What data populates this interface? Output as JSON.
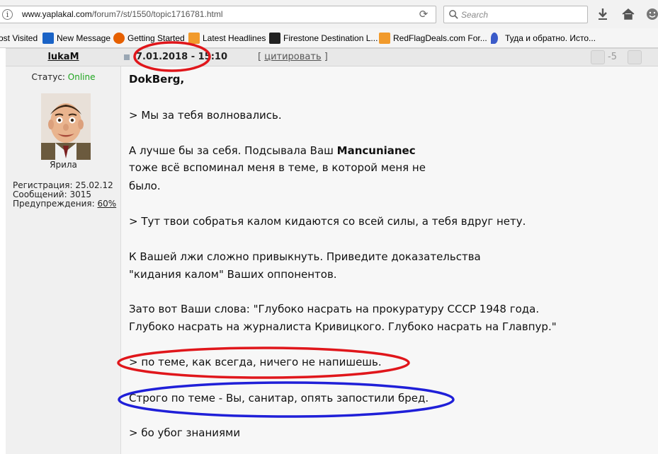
{
  "browser": {
    "url_host": "www.yaplakal.com",
    "url_path": "/forum7/st/1550/topic1716781.html",
    "search_placeholder": "Search",
    "bookmarks": [
      {
        "label": "ost Visited",
        "icon": "firefox-icon"
      },
      {
        "label": "New Message",
        "icon": "outlook-icon"
      },
      {
        "label": "Getting Started",
        "icon": "firefox-icon"
      },
      {
        "label": "Latest Headlines",
        "icon": "rss-icon"
      },
      {
        "label": "Firestone Destination L...",
        "icon": "firestone-icon"
      },
      {
        "label": "RedFlagDeals.com For...",
        "icon": "rss-icon"
      },
      {
        "label": "Туда и обратно. Исто...",
        "icon": "pin-icon"
      }
    ]
  },
  "post": {
    "author": "lukaM",
    "date": "7.01.2018 - 15:10",
    "quote_open": "[ ",
    "quote_label": "цитировать",
    "quote_close": " ]",
    "vote_score": "-5",
    "status_label": "Статус: ",
    "status_value": "Online",
    "rank": "Ярила",
    "registration": "Регистрация: 25.02.12",
    "messages": "Сообщений: 3015",
    "warnings_label": "Предупреждения: ",
    "warnings_value": "60%",
    "body": {
      "addressee": "DokBerg,",
      "q1": "> Мы за тебя волновались.",
      "a1_line1_pre": "А лучше бы за себя. Подсывала Ваш ",
      "a1_line1_bold": "Mancunianec",
      "a1_line2": "тоже всё вспоминал меня в теме, в которой меня не",
      "a1_line3": "было.",
      "q2": "> Тут твои собратья калом кидаются со всей силы, а тебя вдруг нету.",
      "a2_line1": "К Вашей лжи сложно привыкнуть. Приведите доказательства",
      "a2_line2": "\"кидания калом\" Ваших оппонентов.",
      "a3_line1": "Зато вот Ваши слова: \"Глубоко насрать на прокуратуру СССР 1948 года.",
      "a3_line2": "Глубоко насрать на журналиста Кривицкого. Глубоко насрать на Главпур.\"",
      "q3": "> по теме, как всегда, ничего не напишешь.",
      "a4": "Строго по теме - Вы, санитар, опять запостили бред.",
      "q4": "> бо убог знаниями"
    }
  },
  "colors": {
    "annotation_red": "#e0161b",
    "annotation_blue": "#1f1fd8",
    "online_green": "#1ea51e"
  }
}
